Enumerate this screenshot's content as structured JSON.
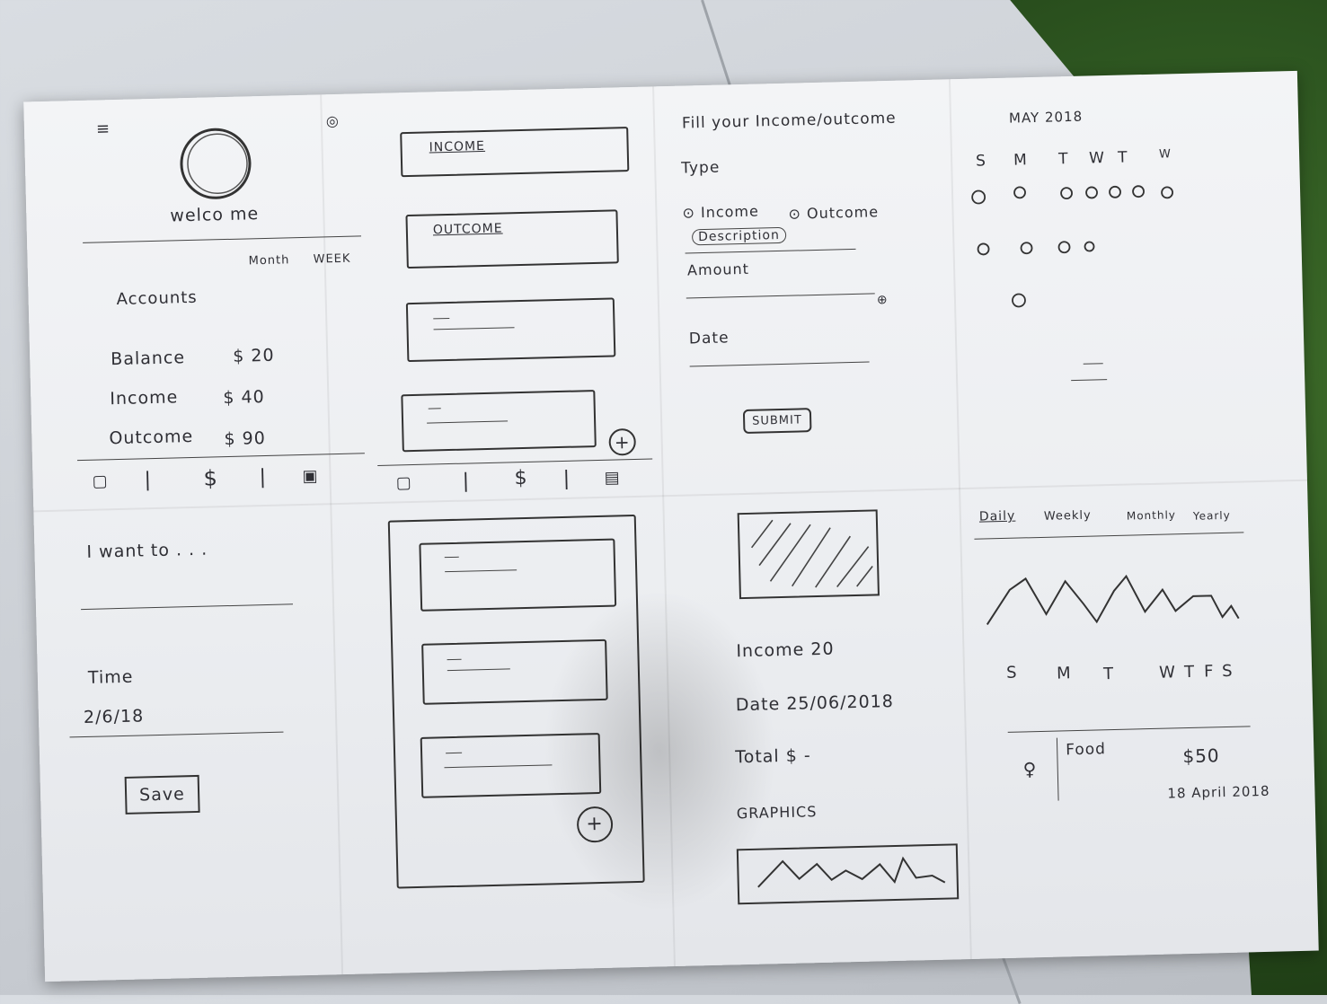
{
  "panel1": {
    "welcome": "welco me",
    "tabs": [
      "Month",
      "WEEK"
    ],
    "accounts": "Accounts",
    "balance_label": "Balance",
    "balance_value": "$ 20",
    "income_label": "Income",
    "income_value": "$ 40",
    "outcome_label": "Outcome",
    "outcome_value": "$ 90",
    "nav_dollar": "$",
    "nav_sep": "|"
  },
  "panel2": {
    "card1": "INCOME",
    "card2": "OUTCOME",
    "nav_dollar": "$",
    "nav_sep": "|",
    "plus": "+"
  },
  "panel3": {
    "heading": "Fill your Income/outcome",
    "type_label": "Type",
    "radio_income": "Income",
    "radio_outcome": "Outcome",
    "description": "Description",
    "amount": "Amount",
    "date": "Date",
    "submit": "SUBMIT"
  },
  "panel4": {
    "month": "MAY 2018",
    "weekdays": [
      "S",
      "M",
      "T",
      "W",
      "T",
      "W"
    ]
  },
  "panel5": {
    "want": "I want to . . .",
    "time": "Time",
    "date_value": "2/6/18",
    "save": "Save"
  },
  "panel6": {
    "plus": "+"
  },
  "panel7": {
    "income": "Income 20",
    "date": "Date 25/06/2018",
    "total": "Total $ -",
    "graphics": "GRAPHICS"
  },
  "panel8": {
    "tabs": [
      "Daily",
      "Weekly",
      "Monthly",
      "Yearly"
    ],
    "days": [
      "S",
      "M",
      "T",
      "W",
      "T",
      "F",
      "S"
    ],
    "item_label": "Food",
    "item_amount": "$50",
    "item_date": "18 April 2018"
  }
}
